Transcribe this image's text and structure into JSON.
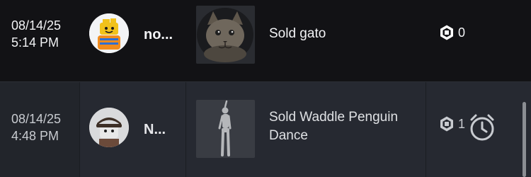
{
  "transactions": [
    {
      "date": "08/14/25",
      "time": "5:14 PM",
      "username": "no...",
      "avatar_icon": "user-avatar-icon",
      "item_label": "Sold gato",
      "price": "0",
      "currency_icon": "robux-icon",
      "status_icon": null
    },
    {
      "date": "08/14/25",
      "time": "4:48 PM",
      "username": "N...",
      "avatar_icon": "user-avatar-icon",
      "item_label": "Sold Waddle Penguin Dance",
      "price": "1",
      "currency_icon": "robux-icon",
      "status_icon": "clock-icon"
    }
  ],
  "colors": {
    "row_dark": "#121215",
    "row_highlight": "#22252b",
    "text_primary": "#f2f3f5",
    "text_secondary": "#c8cbd0"
  }
}
